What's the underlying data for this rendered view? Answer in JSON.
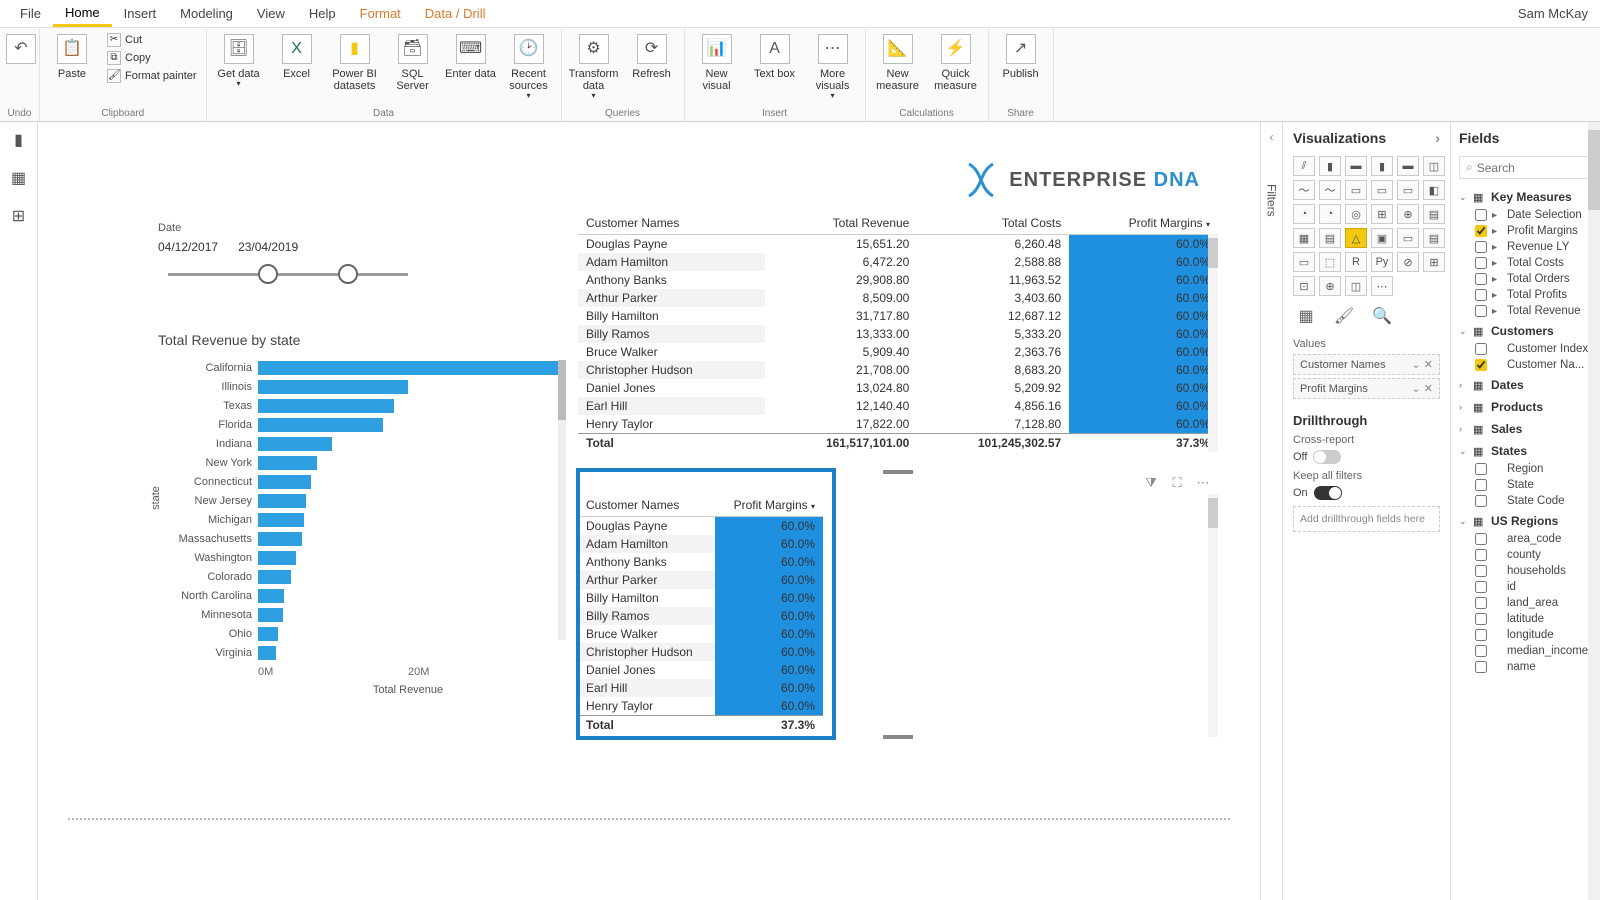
{
  "user": "Sam McKay",
  "menu": [
    "File",
    "Home",
    "Insert",
    "Modeling",
    "View",
    "Help",
    "Format",
    "Data / Drill"
  ],
  "menu_active": 1,
  "menu_accent": [
    6,
    7
  ],
  "ribbon": {
    "undo": "Undo",
    "clipboard": {
      "label": "Clipboard",
      "paste": "Paste",
      "cut": "Cut",
      "copy": "Copy",
      "fmt": "Format painter"
    },
    "data": {
      "label": "Data",
      "get": "Get data",
      "excel": "Excel",
      "pbi": "Power BI datasets",
      "sql": "SQL Server",
      "enter": "Enter data",
      "recent": "Recent sources"
    },
    "queries": {
      "label": "Queries",
      "transform": "Transform data",
      "refresh": "Refresh"
    },
    "insert": {
      "label": "Insert",
      "newv": "New visual",
      "text": "Text box",
      "more": "More visuals"
    },
    "calc": {
      "label": "Calculations",
      "newm": "New measure",
      "quick": "Quick measure"
    },
    "share": {
      "label": "Share",
      "publish": "Publish"
    }
  },
  "slicer": {
    "label": "Date",
    "from": "04/12/2017",
    "to": "23/04/2019"
  },
  "chart_data": {
    "type": "bar",
    "title": "Total Revenue by state",
    "xlabel": "Total Revenue",
    "ylabel": "state",
    "xticks": [
      "0M",
      "20M"
    ],
    "categories": [
      "California",
      "Illinois",
      "Texas",
      "Florida",
      "Indiana",
      "New York",
      "Connecticut",
      "New Jersey",
      "Michigan",
      "Massachusetts",
      "Washington",
      "Colorado",
      "North Carolina",
      "Minnesota",
      "Ohio",
      "Virginia"
    ],
    "values": [
      22,
      11,
      10,
      9.2,
      5.4,
      4.3,
      3.9,
      3.5,
      3.4,
      3.2,
      2.8,
      2.4,
      1.9,
      1.8,
      1.5,
      1.3
    ]
  },
  "table1": {
    "cols": [
      "Customer Names",
      "Total Revenue",
      "Total Costs",
      "Profit Margins"
    ],
    "rows": [
      [
        "Douglas Payne",
        "15,651.20",
        "6,260.48",
        "60.0%"
      ],
      [
        "Adam Hamilton",
        "6,472.20",
        "2,588.88",
        "60.0%"
      ],
      [
        "Anthony Banks",
        "29,908.80",
        "11,963.52",
        "60.0%"
      ],
      [
        "Arthur Parker",
        "8,509.00",
        "3,403.60",
        "60.0%"
      ],
      [
        "Billy Hamilton",
        "31,717.80",
        "12,687.12",
        "60.0%"
      ],
      [
        "Billy Ramos",
        "13,333.00",
        "5,333.20",
        "60.0%"
      ],
      [
        "Bruce Walker",
        "5,909.40",
        "2,363.76",
        "60.0%"
      ],
      [
        "Christopher Hudson",
        "21,708.00",
        "8,683.20",
        "60.0%"
      ],
      [
        "Daniel Jones",
        "13,024.80",
        "5,209.92",
        "60.0%"
      ],
      [
        "Earl Hill",
        "12,140.40",
        "4,856.16",
        "60.0%"
      ],
      [
        "Henry Taylor",
        "17,822.00",
        "7,128.80",
        "60.0%"
      ]
    ],
    "total": [
      "Total",
      "161,517,101.00",
      "101,245,302.57",
      "37.3%"
    ]
  },
  "table2": {
    "cols": [
      "Customer Names",
      "Profit Margins"
    ],
    "rows": [
      [
        "Douglas Payne",
        "60.0%"
      ],
      [
        "Adam Hamilton",
        "60.0%"
      ],
      [
        "Anthony Banks",
        "60.0%"
      ],
      [
        "Arthur Parker",
        "60.0%"
      ],
      [
        "Billy Hamilton",
        "60.0%"
      ],
      [
        "Billy Ramos",
        "60.0%"
      ],
      [
        "Bruce Walker",
        "60.0%"
      ],
      [
        "Christopher Hudson",
        "60.0%"
      ],
      [
        "Daniel Jones",
        "60.0%"
      ],
      [
        "Earl Hill",
        "60.0%"
      ],
      [
        "Henry Taylor",
        "60.0%"
      ]
    ],
    "total": [
      "Total",
      "37.3%"
    ]
  },
  "logo": {
    "text1": "ENTERPRISE ",
    "text2": "DNA"
  },
  "viz": {
    "title": "Visualizations",
    "values_label": "Values",
    "wells": [
      "Customer Names",
      "Profit Margins"
    ],
    "drill_title": "Drillthrough",
    "cross": "Cross-report",
    "cross_state": "Off",
    "keep": "Keep all filters",
    "keep_state": "On",
    "drill_ph": "Add drillthrough fields here"
  },
  "filters_label": "Filters",
  "fields": {
    "title": "Fields",
    "search_ph": "Search",
    "groups": [
      {
        "name": "Key Measures",
        "open": true,
        "icon": "▦",
        "items": [
          {
            "n": "Date Selection",
            "c": false,
            "i": "▸"
          },
          {
            "n": "Profit Margins",
            "c": true,
            "i": "▸"
          },
          {
            "n": "Revenue LY",
            "c": false,
            "i": "▸"
          },
          {
            "n": "Total Costs",
            "c": false,
            "i": "▸"
          },
          {
            "n": "Total Orders",
            "c": false,
            "i": "▸"
          },
          {
            "n": "Total Profits",
            "c": false,
            "i": "▸"
          },
          {
            "n": "Total Revenue",
            "c": false,
            "i": "▸"
          }
        ]
      },
      {
        "name": "Customers",
        "open": true,
        "icon": "▦",
        "items": [
          {
            "n": "Customer Index",
            "c": false,
            "i": ""
          },
          {
            "n": "Customer Na...",
            "c": true,
            "i": ""
          }
        ]
      },
      {
        "name": "Dates",
        "open": false,
        "icon": "▦",
        "items": []
      },
      {
        "name": "Products",
        "open": false,
        "icon": "▦",
        "items": []
      },
      {
        "name": "Sales",
        "open": false,
        "icon": "▦",
        "items": []
      },
      {
        "name": "States",
        "open": true,
        "icon": "▦",
        "items": [
          {
            "n": "Region",
            "c": false,
            "i": ""
          },
          {
            "n": "State",
            "c": false,
            "i": ""
          },
          {
            "n": "State Code",
            "c": false,
            "i": ""
          }
        ]
      },
      {
        "name": "US Regions",
        "open": true,
        "icon": "▦",
        "items": [
          {
            "n": "area_code",
            "c": false,
            "i": ""
          },
          {
            "n": "county",
            "c": false,
            "i": ""
          },
          {
            "n": "households",
            "c": false,
            "i": ""
          },
          {
            "n": "id",
            "c": false,
            "i": ""
          },
          {
            "n": "land_area",
            "c": false,
            "i": ""
          },
          {
            "n": "latitude",
            "c": false,
            "i": ""
          },
          {
            "n": "longitude",
            "c": false,
            "i": ""
          },
          {
            "n": "median_income",
            "c": false,
            "i": ""
          },
          {
            "n": "name",
            "c": false,
            "i": ""
          }
        ]
      }
    ]
  }
}
